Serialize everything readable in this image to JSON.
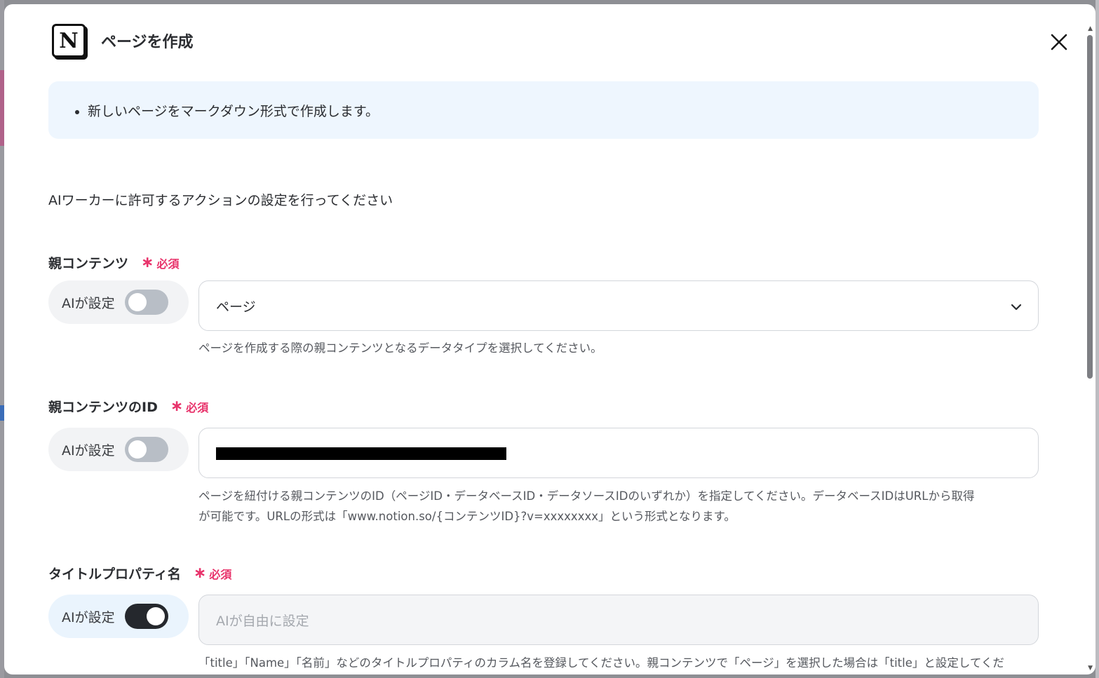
{
  "dialog": {
    "title": "ページを作成",
    "logo_letter": "N",
    "logo_icon": "notion-logo-icon",
    "close_icon": "close-icon"
  },
  "info": {
    "bullets": [
      "新しいページをマークダウン形式で作成します。"
    ]
  },
  "intro": "AIワーカーに許可するアクションの設定を行ってください",
  "required_label": "必須",
  "ai_toggle_label": "AIが設定",
  "fields": [
    {
      "label": "親コンテンツ",
      "ai_enabled": false,
      "value": "ページ",
      "control": "select",
      "help": "ページを作成する際の親コンテンツとなるデータタイプを選択してください。"
    },
    {
      "label": "親コンテンツのID",
      "ai_enabled": false,
      "value": "",
      "value_redacted": true,
      "control": "text",
      "help_line1": "ページを紐付ける親コンテンツのID（ページID・データベースID・データソースIDのいずれか）を指定してください。データベースIDはURLから取得",
      "help_line2": "が可能です。URLの形式は「www.notion.so/{コンテンツID}?v=xxxxxxxx」という形式となります。"
    },
    {
      "label": "タイトルプロパティ名",
      "ai_enabled": true,
      "placeholder": "AIが自由に設定",
      "control": "text",
      "help": "「title」「Name」「名前」などのタイトルプロパティのカラム名を登録してください。親コンテンツで「ページ」を選択した場合は「title」と設定してくだ"
    }
  ],
  "colors": {
    "accent_required": "#e8336b",
    "toggle_on": "#25282d",
    "toggle_off": "#b8bec6",
    "info_bg": "#eef6fe"
  }
}
